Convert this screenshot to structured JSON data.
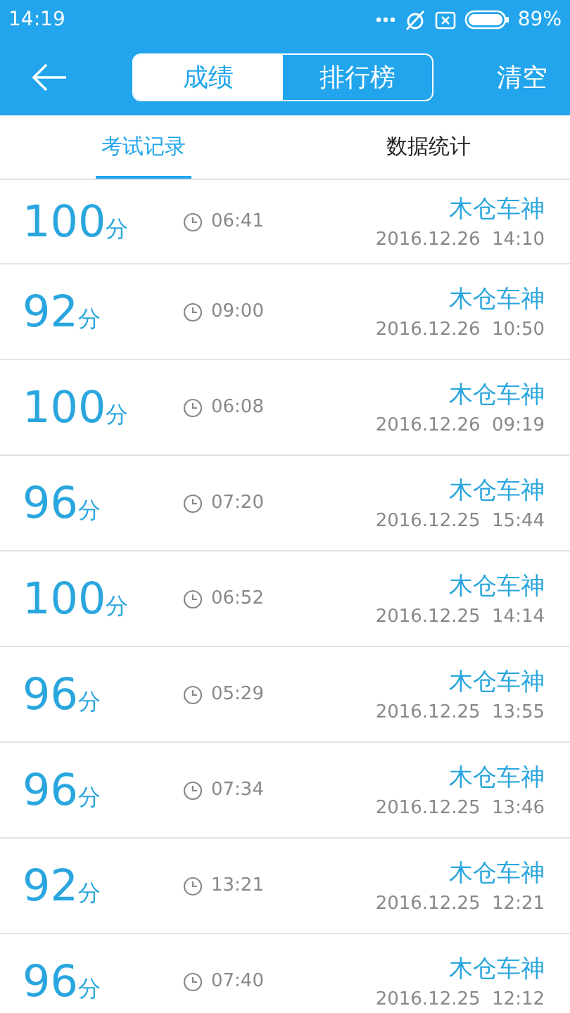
{
  "status_bar": {
    "time": "14:19",
    "battery_text": "89%"
  },
  "app_bar": {
    "segments": [
      {
        "label": "成绩",
        "selected": true
      },
      {
        "label": "排行榜",
        "selected": false
      }
    ],
    "action": "清空"
  },
  "tabs": [
    {
      "label": "考试记录",
      "selected": true
    },
    {
      "label": "数据统计",
      "selected": false
    }
  ],
  "records": [
    {
      "score": "100",
      "unit": "分",
      "duration": "06:41",
      "name": "木仓车神",
      "date": "2016.12.26  14:10"
    },
    {
      "score": "92",
      "unit": "分",
      "duration": "09:00",
      "name": "木仓车神",
      "date": "2016.12.26  10:50"
    },
    {
      "score": "100",
      "unit": "分",
      "duration": "06:08",
      "name": "木仓车神",
      "date": "2016.12.26  09:19"
    },
    {
      "score": "96",
      "unit": "分",
      "duration": "07:20",
      "name": "木仓车神",
      "date": "2016.12.25  15:44"
    },
    {
      "score": "100",
      "unit": "分",
      "duration": "06:52",
      "name": "木仓车神",
      "date": "2016.12.25  14:14"
    },
    {
      "score": "96",
      "unit": "分",
      "duration": "05:29",
      "name": "木仓车神",
      "date": "2016.12.25  13:55"
    },
    {
      "score": "96",
      "unit": "分",
      "duration": "07:34",
      "name": "木仓车神",
      "date": "2016.12.25  13:46"
    },
    {
      "score": "92",
      "unit": "分",
      "duration": "13:21",
      "name": "木仓车神",
      "date": "2016.12.25  12:21"
    },
    {
      "score": "96",
      "unit": "分",
      "duration": "07:40",
      "name": "木仓车神",
      "date": "2016.12.25  12:12"
    }
  ]
}
